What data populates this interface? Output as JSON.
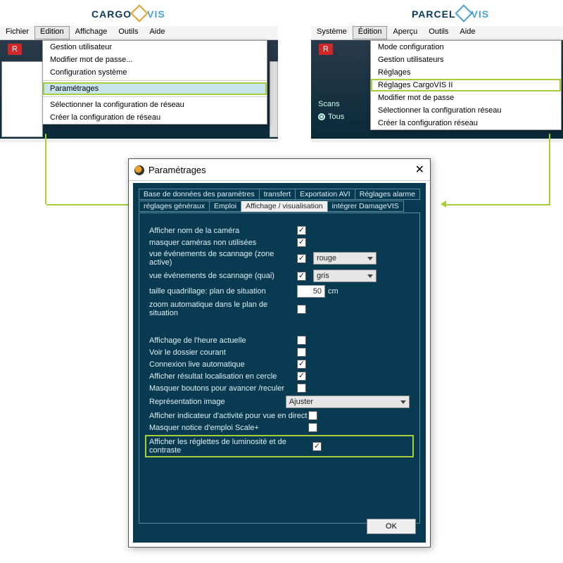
{
  "logos": {
    "left_a": "CARGO",
    "left_b": "VIS",
    "right_a": "PARCEL",
    "right_b": "VIS"
  },
  "leftMenus": [
    "Fichier",
    "Edition",
    "Affichage",
    "Outils",
    "Aide"
  ],
  "rightMenus": [
    "Système",
    "Édition",
    "Aperçu",
    "Outils",
    "Aide"
  ],
  "leftDropdown": {
    "items_a": [
      "Gestion utilisateur",
      "Modifier mot de passe...",
      "Configuration système"
    ],
    "highlight": "Paramétrages",
    "items_b": [
      "Sélectionner la configuration de réseau",
      "Créer la configuration de réseau"
    ]
  },
  "rightDropdown": {
    "items_a": [
      "Mode configuration",
      "Gestion utilisateurs",
      "Réglages"
    ],
    "highlight": "Réglages CargoVIS II",
    "items_b": [
      "Modifier mot de passe",
      "Sélectionner la configuration réseau",
      "Créer la configuration réseau"
    ]
  },
  "rightScans": {
    "label": "Scans",
    "opt": "Tous"
  },
  "rBadge": "R",
  "dialog": {
    "title": "Paramétrages",
    "tabs_row1": [
      "Base de données des paramètres",
      "transfert",
      "Exportation AVI",
      "Réglages alarme"
    ],
    "tabs_row2_a": [
      "réglages généraux",
      "Emploi"
    ],
    "tabs_active": "Affichage / visualisation",
    "tabs_row2_b": [
      "intégrer DamageVIS"
    ],
    "rows": {
      "r1": "Afficher nom de la caméra",
      "r2": "masquer caméras non utilisées",
      "r3": "vue événements de scannage (zone active)",
      "r3_sel": "rouge",
      "r4": "vue événements de scannage (quai)",
      "r4_sel": "gris",
      "r5": "taille quadrillage: plan de situation",
      "r5_val": "50",
      "r5_unit": "cm",
      "r6": "zoom automatique dans le plan de situation",
      "r7": "Affichage de l'heure actuelle",
      "r8": "Voir le dossier courant",
      "r9": "Connexion live automatique",
      "r10": "Afficher résultat localisation en cercle",
      "r11": "Masquer boutons pour avancer /reculer",
      "r12": "Représentation image",
      "r12_sel": "Ajuster",
      "r13": "Afficher indicateur d'activité  pour vue en direct",
      "r14": "Masquer notice d'emploi Scale+",
      "r15": "Afficher les réglettes de luminosité et de contraste"
    },
    "ok": "OK"
  }
}
